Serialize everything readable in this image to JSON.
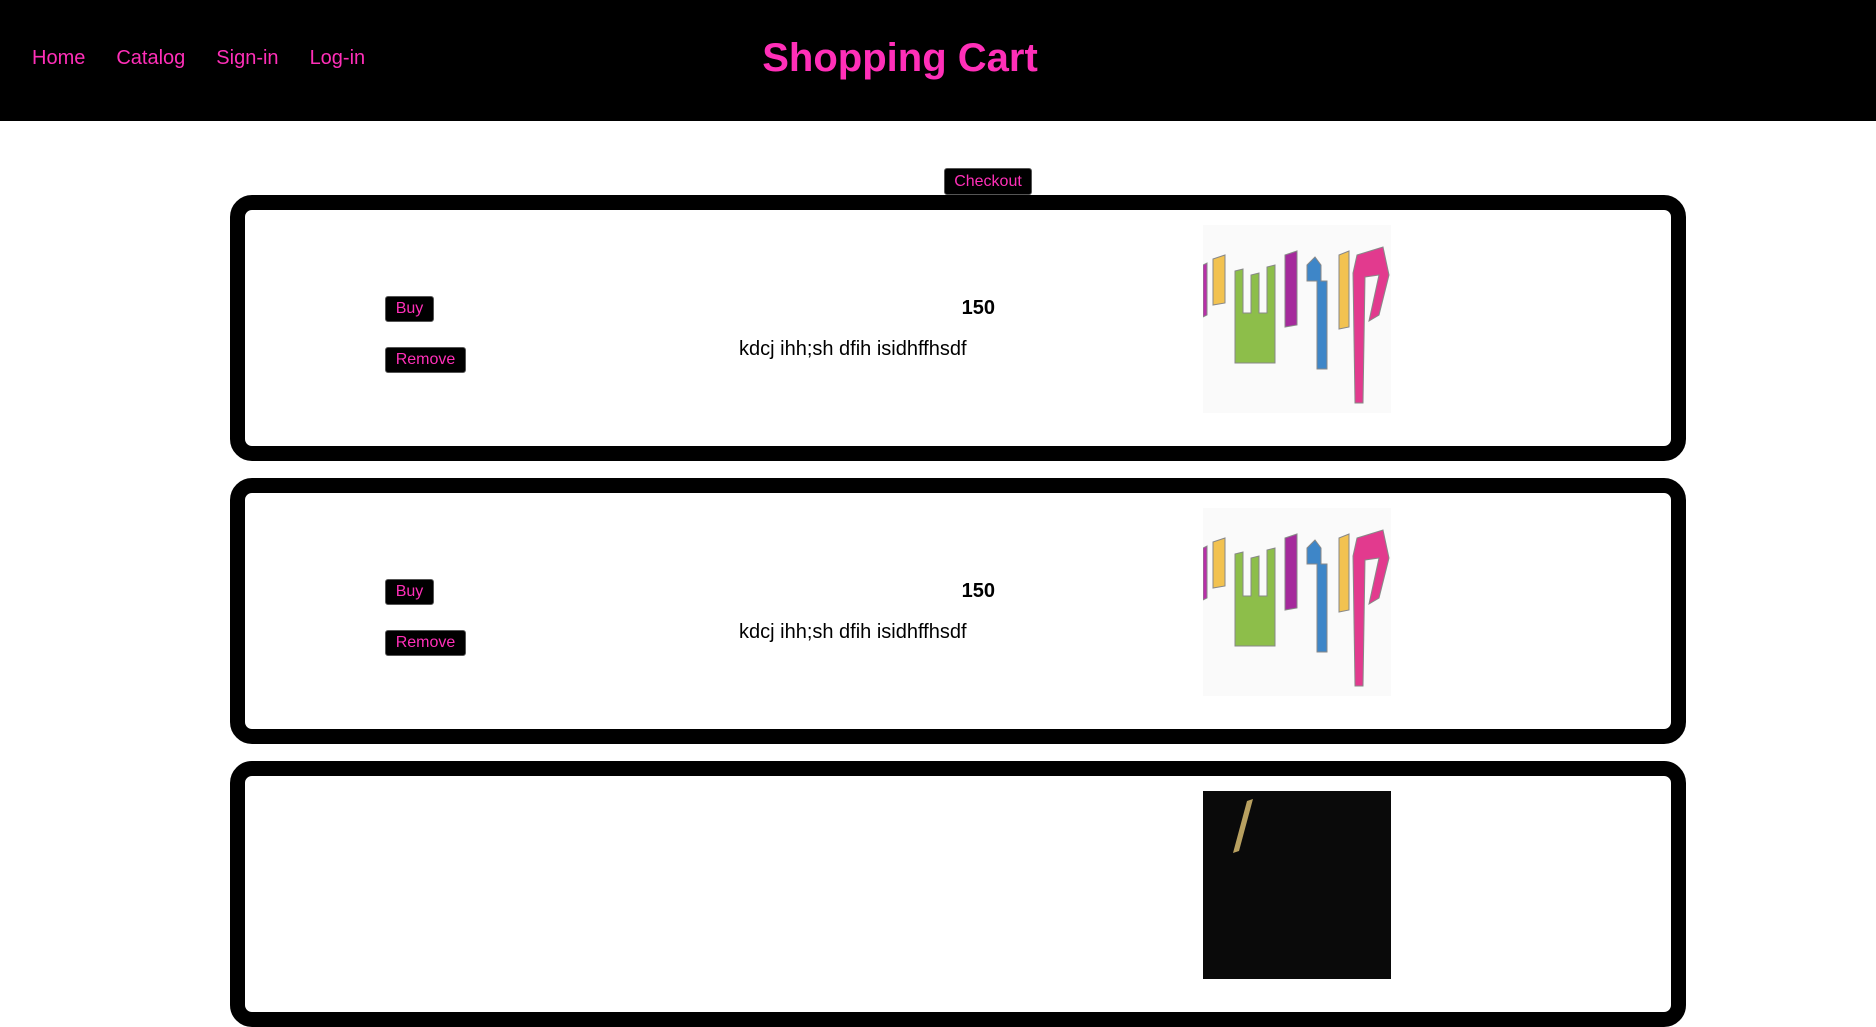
{
  "header": {
    "nav": [
      {
        "label": "Home"
      },
      {
        "label": "Catalog"
      },
      {
        "label": "Sign-in"
      },
      {
        "label": "Log-in"
      }
    ],
    "title": "Shopping Cart"
  },
  "checkout_label": "Checkout",
  "colors": {
    "accent": "#ff2fb8",
    "header_bg": "#000000",
    "card_border": "#000000"
  },
  "items": [
    {
      "price": "150",
      "description": "kdcj ihh;sh dfih isidhffhsdf",
      "buy_label": "Buy",
      "remove_label": "Remove",
      "image": "colorful-letters-logo"
    },
    {
      "price": "150",
      "description": "kdcj ihh;sh dfih isidhffhsdf",
      "buy_label": "Buy",
      "remove_label": "Remove",
      "image": "colorful-letters-logo"
    },
    {
      "price": "",
      "description": "",
      "buy_label": "",
      "remove_label": "",
      "image": "dark-product-photo"
    }
  ]
}
